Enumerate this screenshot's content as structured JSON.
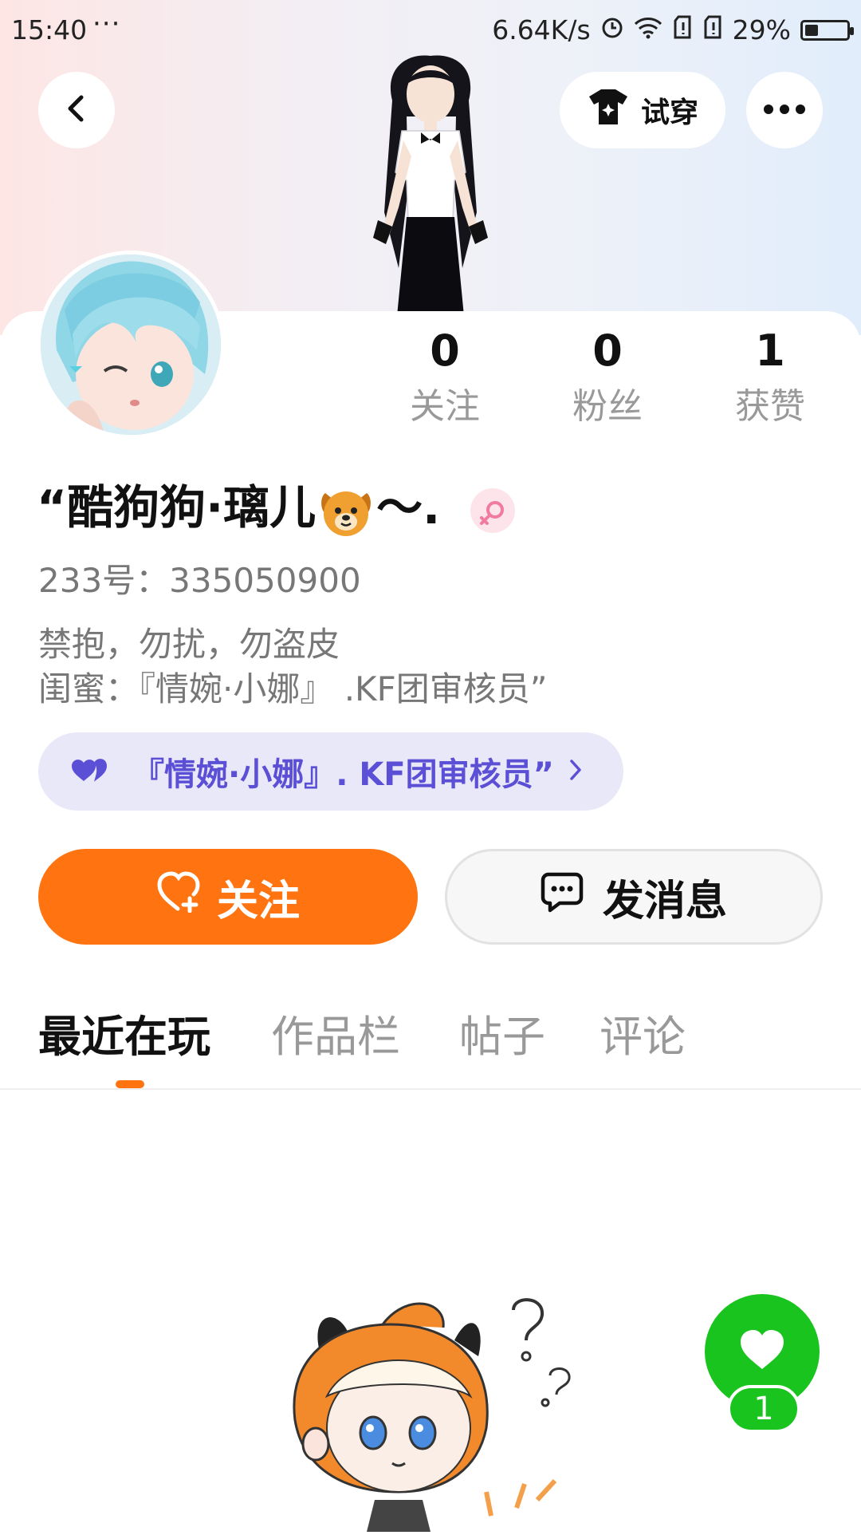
{
  "status_bar": {
    "time": "15:40",
    "more": "···",
    "net_speed": "6.64K/s",
    "battery": "29%",
    "battery_level": 0.29
  },
  "header": {
    "try_on_label": "试穿"
  },
  "stats": [
    {
      "value": "0",
      "label": "关注"
    },
    {
      "value": "0",
      "label": "粉丝"
    },
    {
      "value": "1",
      "label": "获赞"
    }
  ],
  "profile": {
    "nickname_before_emoji": "“酷狗狗·璃儿",
    "nickname_after_emoji": "〜.",
    "uid": "233号：335050900",
    "bio_lines": [
      "禁抱，勿扰，勿盗皮",
      "闺蜜：『情婉·小娜』 .KF团审核员”"
    ],
    "guild_label": "『情婉·小娜』. KF团审核员”"
  },
  "actions": {
    "follow_label": "关注",
    "message_label": "发消息"
  },
  "tabs": [
    "最近在玩",
    "作品栏",
    "帖子",
    "评论"
  ],
  "active_tab": 0,
  "like_fab": {
    "count": "1"
  },
  "colors": {
    "accent": "#ff7410",
    "guild_text": "#5b4fd6",
    "guild_bg": "#e9e8f8",
    "like_green": "#19c41e"
  }
}
